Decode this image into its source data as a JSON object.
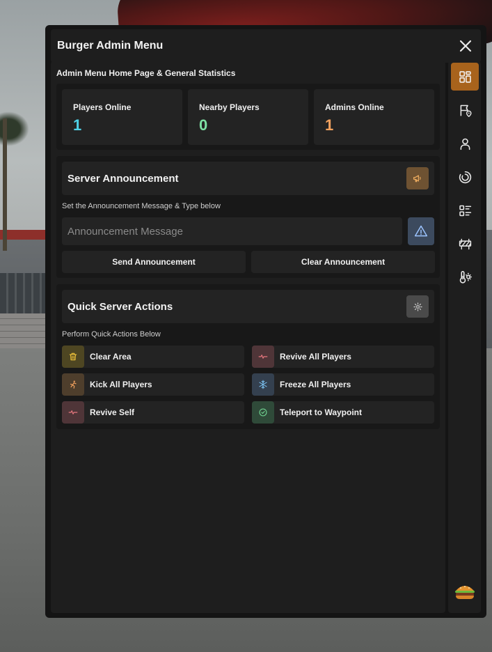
{
  "window": {
    "title": "Burger Admin Menu",
    "close_icon": "close-icon"
  },
  "home": {
    "heading": "Admin Menu Home Page & General Statistics",
    "stats": [
      {
        "label": "Players Online",
        "value": "1",
        "color": "#4fd2e8"
      },
      {
        "label": "Nearby Players",
        "value": "0",
        "color": "#7ee0a4"
      },
      {
        "label": "Admins Online",
        "value": "1",
        "color": "#f3a25f"
      }
    ]
  },
  "announcement": {
    "title": "Server Announcement",
    "header_icon": "megaphone-icon",
    "subtitle": "Set the Announcement Message & Type below",
    "input_value": "",
    "input_placeholder": "Announcement Message",
    "type_icon": "warning-icon",
    "send_label": "Send Announcement",
    "clear_label": "Clear Announcement"
  },
  "quick_actions": {
    "title": "Quick Server Actions",
    "header_icon": "gear-icon",
    "subtitle": "Perform Quick Actions Below",
    "items": [
      {
        "label": "Clear Area",
        "icon": "trash-icon",
        "color": "#f0c33a"
      },
      {
        "label": "Revive All Players",
        "icon": "heartbeat-icon",
        "color": "#e8787f"
      },
      {
        "label": "Kick All Players",
        "icon": "kick-icon",
        "color": "#f3a25f"
      },
      {
        "label": "Freeze All Players",
        "icon": "snowflake-icon",
        "color": "#7cc2f2"
      },
      {
        "label": "Revive Self",
        "icon": "heartbeat-icon",
        "color": "#e8787f"
      },
      {
        "label": "Teleport to Waypoint",
        "icon": "check-circle-icon",
        "color": "#6fd08f"
      }
    ]
  },
  "sidebar": {
    "accent": "#a8631c",
    "items": [
      {
        "icon": "dashboard-icon",
        "active": true
      },
      {
        "icon": "flag-location-icon",
        "active": false
      },
      {
        "icon": "user-icon",
        "active": false
      },
      {
        "icon": "refresh-circle-icon",
        "active": false
      },
      {
        "icon": "list-details-icon",
        "active": false
      },
      {
        "icon": "barrier-icon",
        "active": false
      },
      {
        "icon": "temperature-sun-icon",
        "active": false
      }
    ],
    "logo": "burger-logo-icon"
  }
}
